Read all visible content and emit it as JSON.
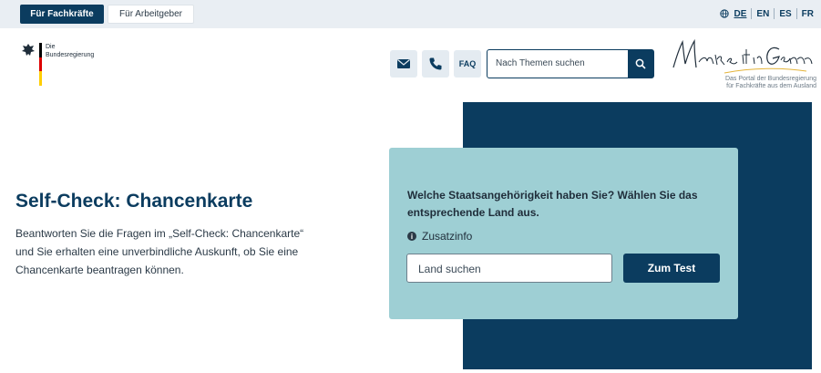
{
  "top_tabs": [
    {
      "label": "Für Fachkräfte",
      "active": true
    },
    {
      "label": "Für Arbeitgeber",
      "active": false
    }
  ],
  "languages": [
    "DE",
    "EN",
    "ES",
    "FR"
  ],
  "active_language": "DE",
  "logo": {
    "line1": "Die",
    "line2": "Bundesregierung"
  },
  "header_buttons": {
    "faq_label": "FAQ"
  },
  "search": {
    "placeholder": "Nach Themen suchen"
  },
  "brand": {
    "signature": "Make it in Germany",
    "subtitle_line1": "Das Portal der Bundesregierung",
    "subtitle_line2": "für Fachkräfte aus dem Ausland"
  },
  "hero": {
    "title": "Self-Check: Chancenkarte",
    "description": "Beantworten Sie die Fragen im „Self-Check: Chancenkarte“ und Sie erhalten eine unverbindliche Auskunft, ob Sie eine Chancenkarte beantragen können."
  },
  "card": {
    "question": "Welche Staatsangehörigkeit haben Sie? Wählen Sie das entsprechende Land aus.",
    "info_label": "Zusatzinfo",
    "info_icon_glyph": "i",
    "country_placeholder": "Land suchen",
    "cta_label": "Zum Test"
  },
  "colors": {
    "primary": "#0b3c5f",
    "card_background": "#9ecfd4",
    "topbar_background": "#e9eef3"
  }
}
